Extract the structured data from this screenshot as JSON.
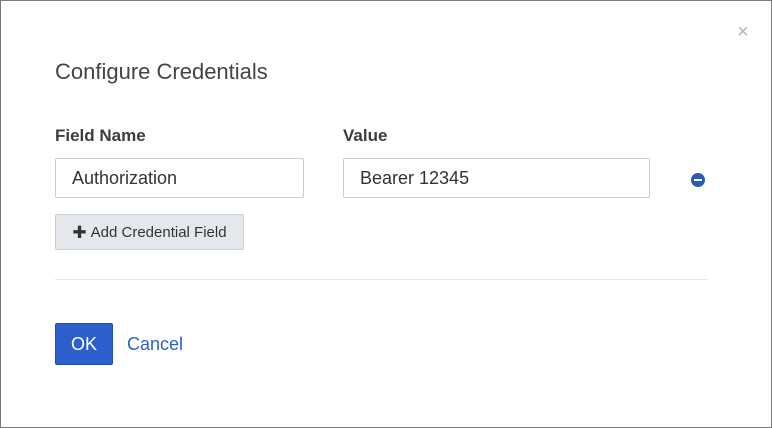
{
  "dialog": {
    "title": "Configure Credentials",
    "close_icon": "close-icon",
    "close_glyph": "×"
  },
  "columns": {
    "field_name_label": "Field Name",
    "value_label": "Value"
  },
  "credentials": [
    {
      "field_name": "Authorization",
      "value": "Bearer 12345",
      "remove_icon": "minus-circle-icon"
    }
  ],
  "actions": {
    "add_icon": "plus-icon",
    "add_glyph": "✚",
    "add_label": "Add Credential Field",
    "ok_label": "OK",
    "cancel_label": "Cancel"
  },
  "colors": {
    "primary": "#2a5fcc",
    "link": "#2f60c4",
    "remove_icon": "#2a5bb7"
  }
}
